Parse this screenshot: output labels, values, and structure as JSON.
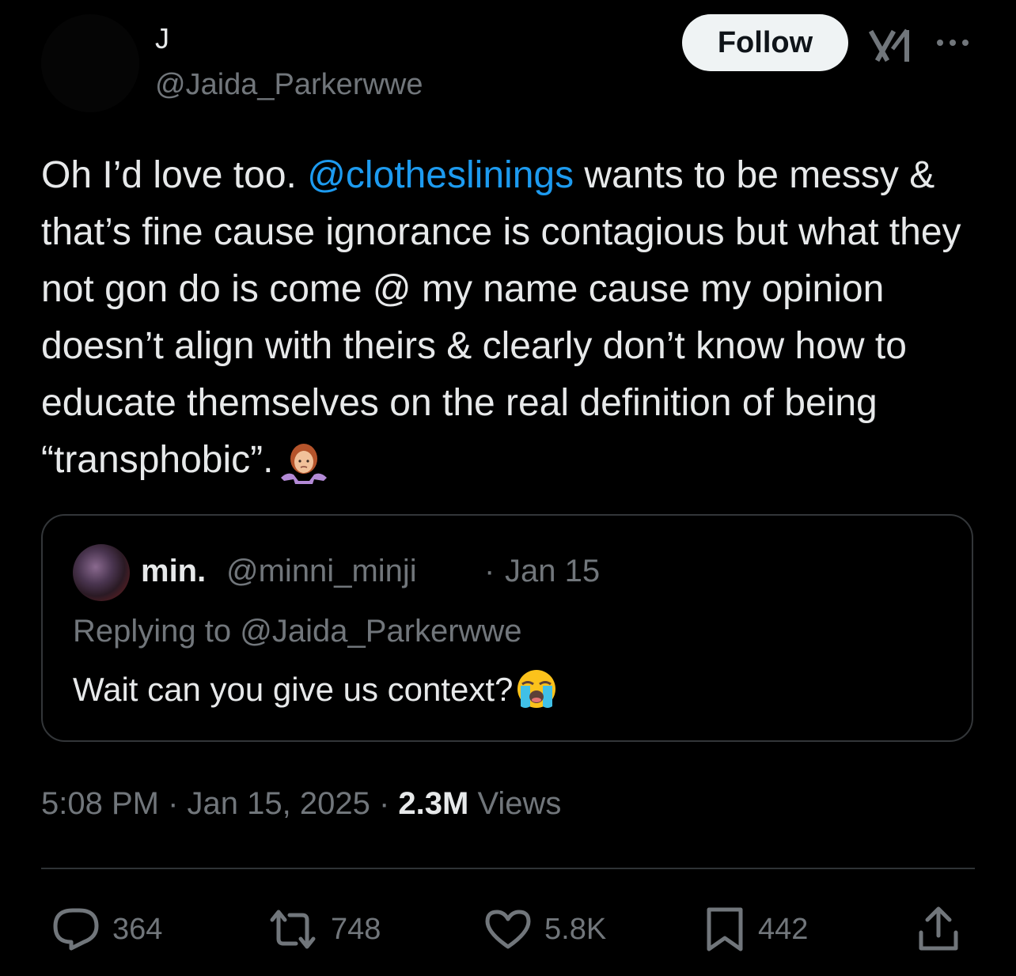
{
  "tweet": {
    "author": {
      "display_name": "J",
      "handle": "@Jaida_Parkerwwe"
    },
    "follow_label": "Follow",
    "text_parts": {
      "before_mention": "Oh I’d love too. ",
      "mention": "@clotheslinings",
      "after_mention": " wants to be messy & that’s fine cause ignorance  is contagious but what they not gon do is come @ my name cause my opinion doesn’t align with theirs & clearly don’t know how to educate themselves on the real definition of being “transphobic”."
    },
    "trailing_emoji": "person-shrugging",
    "timestamp": "5:08 PM",
    "date": "Jan 15, 2025",
    "views_count": "2.3M",
    "views_label": "Views"
  },
  "quote": {
    "name": "min.",
    "handle": "@minni_minji",
    "separator": "·",
    "date": "Jan 15",
    "replying_to": "Replying to @Jaida_Parkerwwe",
    "text": "Wait can you give us context?",
    "emoji": "loudly-crying-face"
  },
  "actions": {
    "replies": "364",
    "reposts": "748",
    "likes": "5.8K",
    "bookmarks": "442"
  },
  "icons": [
    "grok-icon",
    "more-icon",
    "reply-icon",
    "repost-icon",
    "like-icon",
    "bookmark-icon",
    "share-icon"
  ],
  "colors": {
    "background": "#000000",
    "text": "#e7e9ea",
    "secondary": "#71767b",
    "link": "#1d9bf0",
    "follow_bg": "#eff3f4",
    "border": "#333639"
  }
}
